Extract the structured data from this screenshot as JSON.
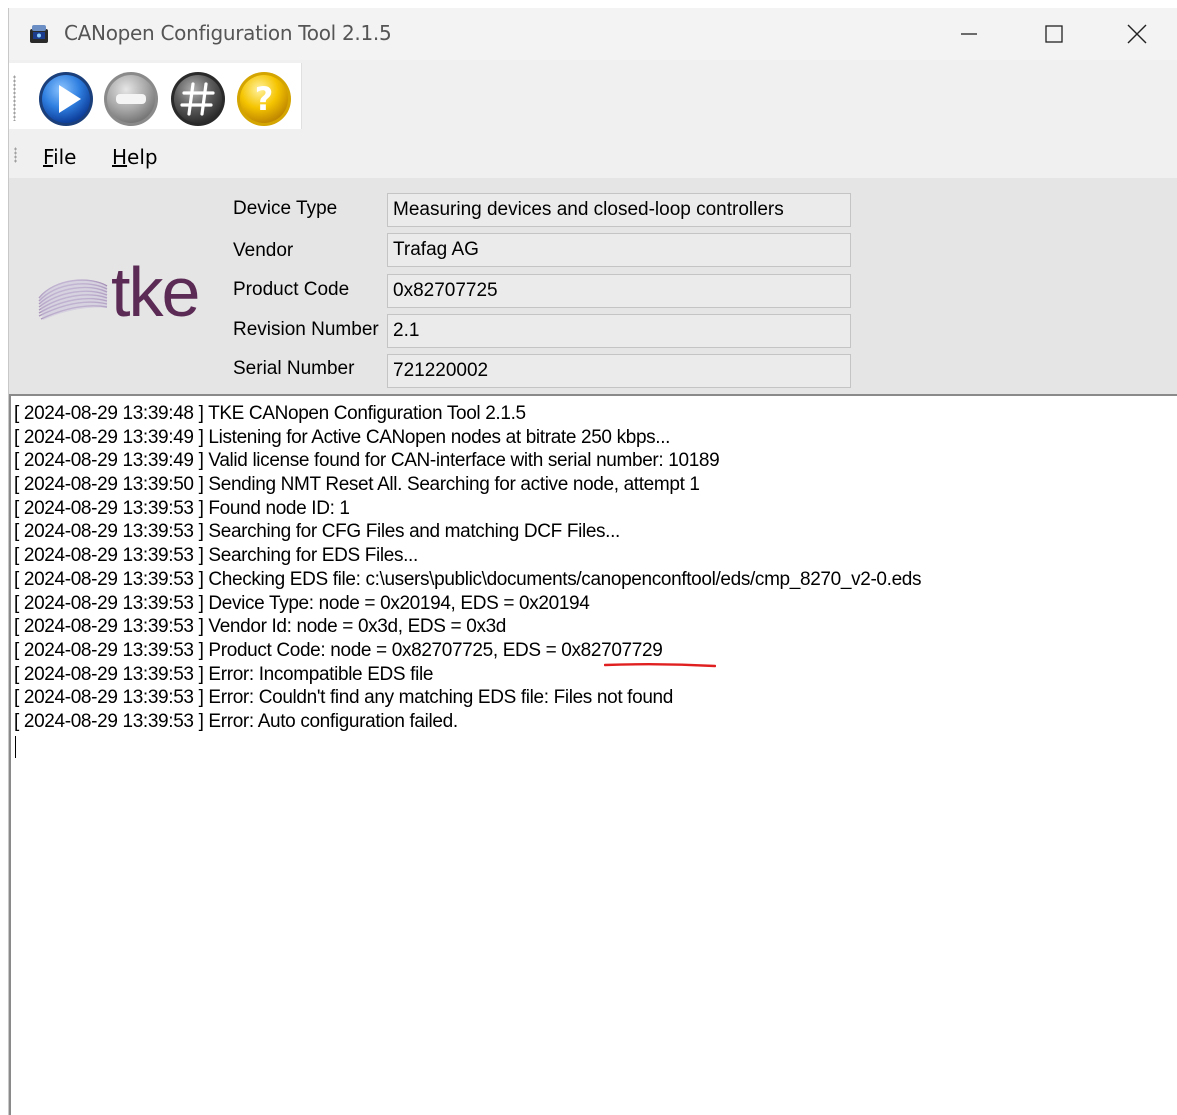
{
  "window": {
    "title": "CANopen Configuration Tool 2.1.5"
  },
  "toolbar": {
    "buttons": [
      {
        "name": "start",
        "icon": "play-icon",
        "color": "#1f6fd0"
      },
      {
        "name": "stop",
        "icon": "stop-icon",
        "color": "#9c9c9c"
      },
      {
        "name": "node-id",
        "icon": "hash-icon",
        "color": "#5a5a5a"
      },
      {
        "name": "help",
        "icon": "question-icon",
        "color": "#f2b800"
      }
    ]
  },
  "menu": {
    "file_first": "F",
    "file_rest": "ile",
    "help_first": "H",
    "help_rest": "elp"
  },
  "brand": {
    "logo_text": "tke",
    "logo_color": "#5b2a55"
  },
  "device": {
    "device_type_label": "Device Type",
    "device_type_value": "Measuring devices and closed-loop controllers",
    "vendor_label": "Vendor",
    "vendor_value": "Trafag AG",
    "product_code_label": "Product Code",
    "product_code_value": "0x82707725",
    "revision_label": "Revision Number",
    "revision_value": "2.1",
    "serial_label": "Serial Number",
    "serial_value": "721220002"
  },
  "log": {
    "lines": [
      "[ 2024-08-29 13:39:48 ] TKE CANopen Configuration Tool 2.1.5",
      "[ 2024-08-29 13:39:49 ] Listening for Active CANopen nodes at bitrate 250 kbps...",
      "[ 2024-08-29 13:39:49 ] Valid license found for CAN-interface with serial number: 10189",
      "[ 2024-08-29 13:39:50 ] Sending NMT Reset All. Searching for active node, attempt 1",
      "[ 2024-08-29 13:39:53 ] Found node ID: 1",
      "[ 2024-08-29 13:39:53 ] Searching for CFG Files and matching DCF Files...",
      "[ 2024-08-29 13:39:53 ] Searching for EDS Files...",
      "[ 2024-08-29 13:39:53 ] Checking EDS file: c:\\users\\public\\documents/canopenconftool/eds/cmp_8270_v2-0.eds",
      "[ 2024-08-29 13:39:53 ] Device Type: node = 0x20194, EDS = 0x20194",
      "[ 2024-08-29 13:39:53 ] Vendor Id: node = 0x3d, EDS = 0x3d",
      "[ 2024-08-29 13:39:53 ] Product Code: node = 0x82707725, EDS = 0x82707729",
      "[ 2024-08-29 13:39:53 ] Error: Incompatible EDS file",
      "[ 2024-08-29 13:39:53 ] Error: Couldn't find any matching EDS file: Files not found",
      "[ 2024-08-29 13:39:53 ] Error: Auto configuration failed."
    ],
    "highlight_color": "#e02020"
  }
}
